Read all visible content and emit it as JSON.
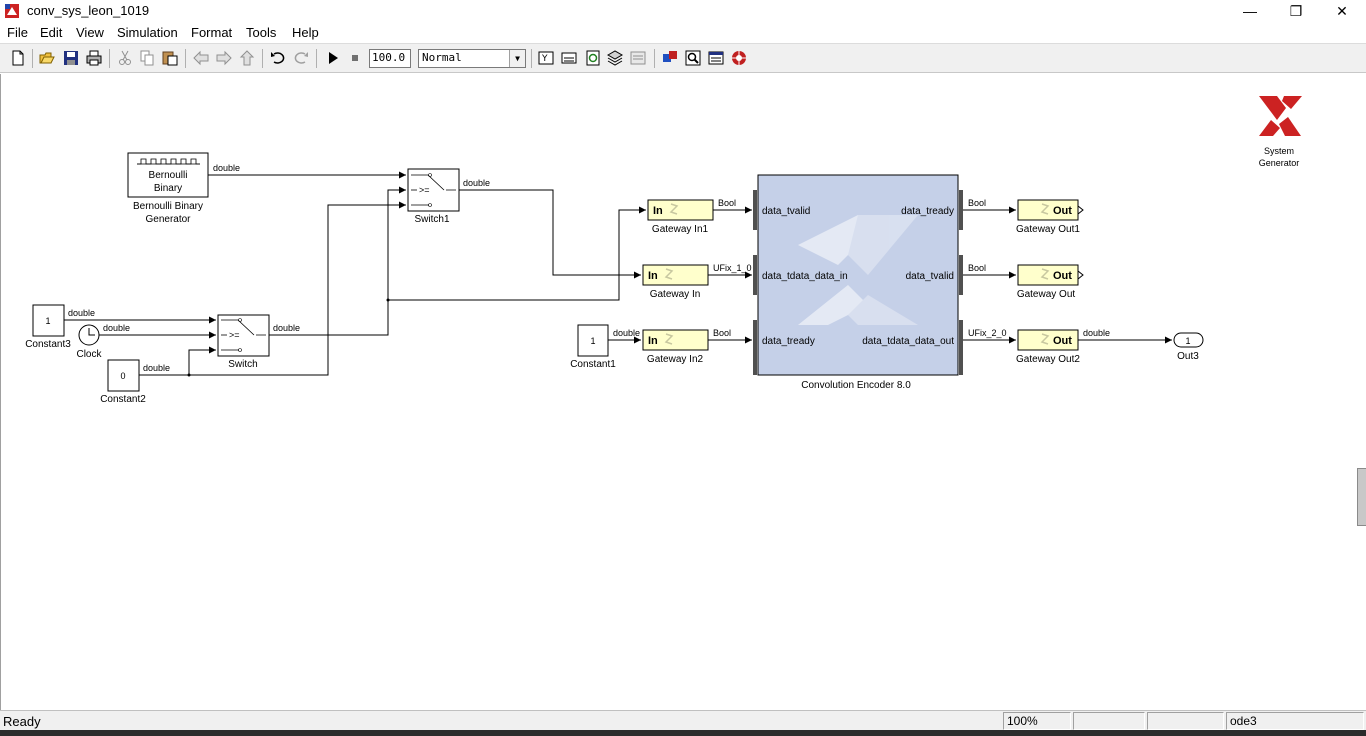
{
  "window": {
    "title": "conv_sys_leon_1019",
    "minimize_glyph": "—",
    "maximize_glyph": "❐",
    "close_glyph": "✕"
  },
  "menu": {
    "items": [
      "File",
      "Edit",
      "View",
      "Simulation",
      "Format",
      "Tools",
      "Help"
    ]
  },
  "toolbar": {
    "stop_time": "100.0",
    "sim_mode": "Normal",
    "icons": [
      "new-model-icon",
      "open-icon",
      "save-icon",
      "print-icon",
      "cut-icon",
      "copy-icon",
      "paste-icon",
      "back-icon",
      "forward-icon",
      "up-icon",
      "undo-icon",
      "redo-icon",
      "run-icon",
      "stop-icon",
      "build-icon",
      "update-diagram-icon",
      "refresh-icon",
      "library-browser-icon",
      "model-explorer-icon",
      "debugger-icon",
      "model-advisor-icon",
      "properties-icon",
      "system-generator-token-icon"
    ]
  },
  "canvas": {
    "logo_label_line1": "System",
    "logo_label_line2": "Generator",
    "blocks": {
      "bernoulli": {
        "text1": "Bernoulli",
        "text2": "Binary",
        "label1": "Bernoulli Binary",
        "label2": "Generator"
      },
      "switch1": {
        "symbol": ">=",
        "label": "Switch1"
      },
      "switch": {
        "symbol": ">=",
        "label": "Switch"
      },
      "constant3": {
        "value": "1",
        "label": "Constant3"
      },
      "clock": {
        "label": "Clock"
      },
      "constant2": {
        "value": "0",
        "label": "Constant2"
      },
      "constant1": {
        "value": "1",
        "label": "Constant1"
      },
      "gateway_in1": {
        "text": "In",
        "label": "Gateway In1"
      },
      "gateway_in": {
        "text": "In",
        "label": "Gateway In"
      },
      "gateway_in2": {
        "text": "In",
        "label": "Gateway In2"
      },
      "conv_encoder": {
        "label": "Convolution Encoder 8.0",
        "in_ports": [
          "data_tvalid",
          "data_tdata_data_in",
          "data_tready"
        ],
        "out_ports": [
          "data_tready",
          "data_tvalid",
          "data_tdata_data_out"
        ]
      },
      "gateway_out1": {
        "text": "Out",
        "label": "Gateway Out1"
      },
      "gateway_out": {
        "text": "Out",
        "label": "Gateway Out"
      },
      "gateway_out2": {
        "text": "Out",
        "label": "Gateway Out2"
      },
      "out3": {
        "value": "1",
        "label": "Out3"
      }
    },
    "signals": {
      "bernoulli_out": "double",
      "switch1_out": "double",
      "constant3_out": "double",
      "clock_out": "double",
      "switch_out": "double",
      "constant2_out": "double",
      "constant1_out": "double",
      "gw_in1_out": "Bool",
      "gw_in_out": "UFix_1_0",
      "gw_in2_out": "Bool",
      "enc_tready_out": "Bool",
      "enc_tvalid_out": "Bool",
      "enc_tdata_out": "UFix_2_0",
      "gw_out2_out": "double"
    }
  },
  "status": {
    "text": "Ready",
    "zoom": "100%",
    "cell_empty_1": "",
    "cell_empty_2": "",
    "solver": "ode3"
  }
}
